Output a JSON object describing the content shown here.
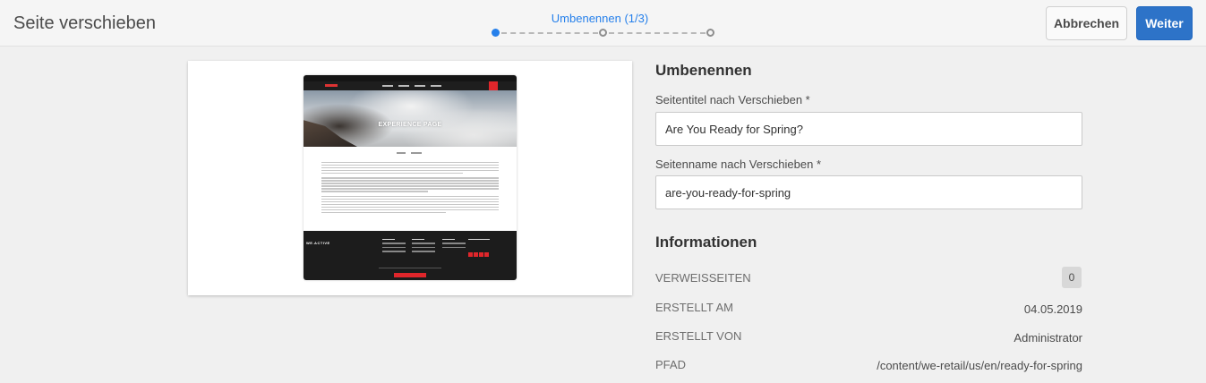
{
  "header": {
    "title": "Seite verschieben",
    "wizard": {
      "current_step_label": "Umbenennen (1/3)",
      "current_step": 1,
      "total_steps": 3
    },
    "cancel_label": "Abbrechen",
    "next_label": "Weiter"
  },
  "preview": {
    "hero_title": "EXPERIENCE PAGE",
    "footer_brand": "WE.ACTIVE"
  },
  "rename": {
    "heading": "Umbenennen",
    "page_title_label": "Seitentitel nach Verschieben *",
    "page_title_value": "Are You Ready for Spring?",
    "page_name_label": "Seitenname nach Verschieben *",
    "page_name_value": "are-you-ready-for-spring"
  },
  "info": {
    "heading": "Informationen",
    "references_label": "VERWEISSEITEN",
    "references_count": "0",
    "created_label": "ERSTELLT AM",
    "created_value": "04.05.2019",
    "created_by_label": "ERSTELLT VON",
    "created_by_value": "Administrator",
    "path_label": "PFAD",
    "path_value": "/content/we-retail/us/en/ready-for-spring"
  },
  "colors": {
    "accent": "#2680eb",
    "primary_button": "#2d73c8",
    "brand_red": "#e0262b"
  }
}
